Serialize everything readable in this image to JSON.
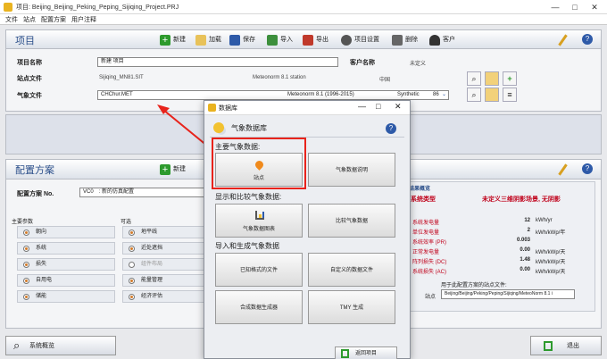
{
  "window": {
    "title": "项目: Beijing_Beijing_Peking_Peping_Sijiqing_Project.PRJ",
    "controls": [
      "—",
      "□",
      "✕"
    ]
  },
  "menu": [
    "文件",
    "站点",
    "配置方案",
    "用户注释"
  ],
  "project": {
    "title": "项目",
    "toolbar": [
      "新建",
      "加载",
      "保存",
      "导入",
      "导出",
      "项目设置",
      "删除",
      "客户"
    ],
    "name_label": "项目名称",
    "name_value": "新建 项目",
    "client_label": "客户名称",
    "client_value": "未定义",
    "site_label": "站点文件",
    "site_file": "Sijiqing_MN81.SIT",
    "site_source": "Meteonorm 8.1 station",
    "site_country": "中国",
    "meteo_label": "气象文件",
    "meteo_file": "CHChur.MET",
    "meteo_source": "Meteonorm 8.1 (1996-2015)",
    "meteo_type": "Synthetic",
    "meteo_extra": "86"
  },
  "config": {
    "title": "配置方案",
    "toolbar_new": "新建",
    "variant_label": "配置方案 No.",
    "variant_value": "VC0",
    "variant_name": ": 新的仿真配置",
    "main_params_title": "主要参数",
    "main_params": [
      "朝向",
      "系统",
      "损失",
      "自用电",
      "储能"
    ],
    "optional_title": "可选",
    "optional": [
      "地平线",
      "近处遮挡",
      "组件布局",
      "能量管理",
      "经济评估"
    ],
    "results_title": "结果概览",
    "system_type_label": "系统类型",
    "system_type_value": "未定义三维阴影场景, 无阴影",
    "results": [
      {
        "label": "系统发电量",
        "value": "12",
        "unit": "kWh/yr"
      },
      {
        "label": "单位发电量",
        "value": "2",
        "unit": "kWh/kWp/年"
      },
      {
        "label": "系统效率 (PR)",
        "value": "0.003",
        "unit": ""
      },
      {
        "label": "正常发电量",
        "value": "0.00",
        "unit": "kWh/kWp/天"
      },
      {
        "label": "阵列损失 (DC)",
        "value": "1.48",
        "unit": "kWh/kWp/天"
      },
      {
        "label": "系统损失 (AC)",
        "value": "0.00",
        "unit": "kWh/kWp/天"
      }
    ],
    "used_site_label": "用于此配置方案的站点文件:",
    "used_site_prefix": "站点",
    "used_site_value": "Beijing/Beijing/Peking/Peping/Sijiqing/MeteoNorm 8.1 i"
  },
  "bottom": {
    "overview": "系统概览",
    "exit": "退出"
  },
  "dialog": {
    "title": "数据库",
    "heading": "气象数据库",
    "sec1": "主要气象数据:",
    "site_btn": "站点",
    "meteo_desc_btn": "气象数据说明",
    "sec2": "显示和比较气象数据:",
    "tables_btn": "气象数据图表",
    "compare_btn": "比较气象数据",
    "sec3": "导入和生成气象数据",
    "known_btn": "已知格式的文件",
    "custom_btn": "自定义的数据文件",
    "synth_btn": "合成数据生成器",
    "tmy_btn": "TMY 生成",
    "back_btn": "返回项目"
  },
  "colors": {
    "accent": "#2b4f8a",
    "highlight": "#e8231b",
    "result_red": "#c0001a",
    "dialog_bg": "#eceef2"
  }
}
